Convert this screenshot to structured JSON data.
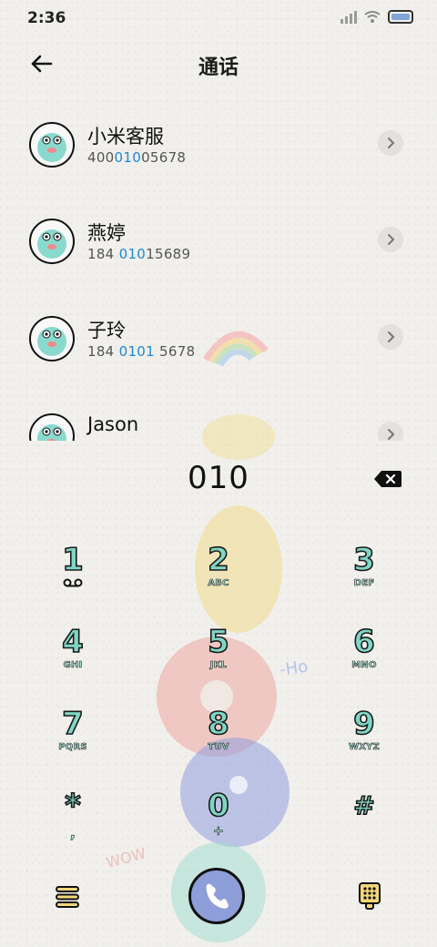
{
  "status_bar": {
    "time": "2:36",
    "signal_icon": "cellular-signal-icon",
    "wifi_icon": "wifi-icon",
    "battery_icon": "battery-icon",
    "battery_color": "#7fa6d9"
  },
  "header": {
    "title": "通话",
    "back_icon": "arrow-left-icon"
  },
  "contacts": [
    {
      "name": "小米客服",
      "number_pre": "400",
      "number_match": "010",
      "number_post": "05678"
    },
    {
      "name": "燕婷",
      "number_pre": "184 ",
      "number_match": "010",
      "number_post": "15689"
    },
    {
      "name": "子玲",
      "number_pre": "184 ",
      "number_match": "0101",
      "number_post": " 5678"
    },
    {
      "name": "Jason",
      "number_pre": "",
      "number_match": "",
      "number_post": ""
    }
  ],
  "highlight_color": "#1e88d4",
  "dialer": {
    "input_value": "010",
    "backspace_icon": "backspace-icon",
    "keys": [
      {
        "num": "1",
        "letters": "voicemail-icon"
      },
      {
        "num": "2",
        "letters": "ABC"
      },
      {
        "num": "3",
        "letters": "DEF"
      },
      {
        "num": "4",
        "letters": "GHI"
      },
      {
        "num": "5",
        "letters": "JKL"
      },
      {
        "num": "6",
        "letters": "MNO"
      },
      {
        "num": "7",
        "letters": "PQRS"
      },
      {
        "num": "8",
        "letters": "TUV"
      },
      {
        "num": "9",
        "letters": "WXYZ"
      },
      {
        "num": "*",
        "letters": ","
      },
      {
        "num": "0",
        "letters": "+"
      },
      {
        "num": "#",
        "letters": ""
      }
    ],
    "key_color": "#7fd6c4",
    "menu_icon": "menu-icon",
    "call_icon": "phone-icon",
    "call_button_color": "#8e9ed8",
    "keypad_toggle_icon": "keypad-icon"
  }
}
